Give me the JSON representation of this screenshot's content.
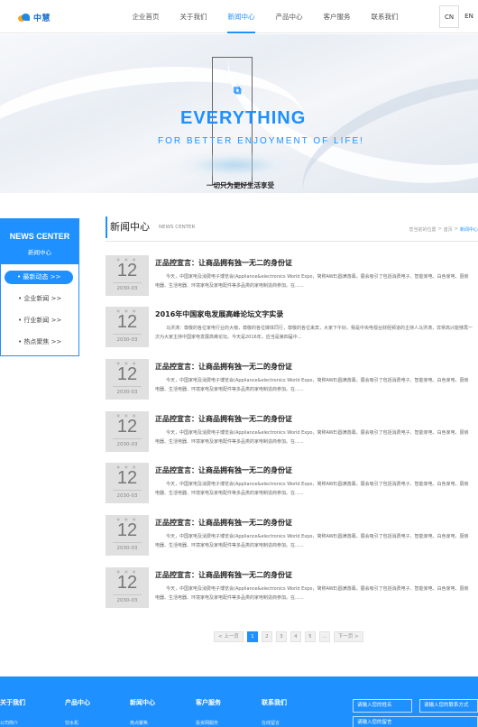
{
  "header": {
    "logo_text": "中慧",
    "nav": [
      "企业首页",
      "关于我们",
      "新闻中心",
      "产品中心",
      "客户服务",
      "联系我们"
    ],
    "active_nav": 2,
    "lang_cn": "CN",
    "lang_en": "EN"
  },
  "banner": {
    "headline": "EVERYTHING",
    "subline": "FOR BETTER ENJOYMENT OF LIFE!",
    "slogan": "一切只为更好生活享受"
  },
  "sidebar": {
    "title_en": "NEWS CENTER",
    "title_zh": "新闻中心",
    "items": [
      "• 最新动态 >>",
      "• 企业新闻 >>",
      "• 行业新闻 >>",
      "• 热点聚焦 >>"
    ],
    "active_index": 0
  },
  "main": {
    "title": "新闻中心",
    "title_en": "NEWS CENTER",
    "breadcrumb": [
      "您当前的位置",
      ">",
      "首页",
      ">",
      "新闻中心"
    ]
  },
  "news": [
    {
      "day": "12",
      "ym": "2030-03",
      "title": "正品控宣言：让商品拥有独一无二的身份证",
      "summary": "今天，中国家电及消费电子博览会(Appliance&electronics World Expo，简称AWE)圆满落幕，展会吸引了包括消费电子、智能家电、白色家电、厨房电器、生活电器、环境家电及家电配件等多品类的家电制造商参加。在......"
    },
    {
      "day": "12",
      "ym": "2030-03",
      "title": "2016年中国家电发展高峰论坛文字实录",
      "summary": "马洪涛：尊敬的各位家电行业的大咖，尊敬的各位媒体同行，尊敬的各位来宾，大家下午好。我是中央电视台财经频道的主持人马洪涛，非常高兴能够再一次为大家主持中国家电发展高峰论坛。今天是2016年，应当是第四届中..."
    },
    {
      "day": "12",
      "ym": "2030-03",
      "title": "正品控宣言：让商品拥有独一无二的身份证",
      "summary": "今天，中国家电及消费电子博览会(Appliance&electronics World Expo，简称AWE)圆满落幕，展会吸引了包括消费电子、智能家电、白色家电、厨房电器、生活电器、环境家电及家电配件等多品类的家电制造商参加。在......"
    },
    {
      "day": "12",
      "ym": "2030-03",
      "title": "正品控宣言：让商品拥有独一无二的身份证",
      "summary": "今天，中国家电及消费电子博览会(Appliance&electronics World Expo，简称AWE)圆满落幕，展会吸引了包括消费电子、智能家电、白色家电、厨房电器、生活电器、环境家电及家电配件等多品类的家电制造商参加。在......"
    },
    {
      "day": "12",
      "ym": "2030-03",
      "title": "正品控宣言：让商品拥有独一无二的身份证",
      "summary": "今天，中国家电及消费电子博览会(Appliance&electronics World Expo，简称AWE)圆满落幕，展会吸引了包括消费电子、智能家电、白色家电、厨房电器、生活电器、环境家电及家电配件等多品类的家电制造商参加。在......"
    },
    {
      "day": "12",
      "ym": "2030-03",
      "title": "正品控宣言：让商品拥有独一无二的身份证",
      "summary": "今天，中国家电及消费电子博览会(Appliance&electronics World Expo，简称AWE)圆满落幕，展会吸引了包括消费电子、智能家电、白色家电、厨房电器、生活电器、环境家电及家电配件等多品类的家电制造商参加。在......"
    },
    {
      "day": "12",
      "ym": "2030-03",
      "title": "正品控宣言：让商品拥有独一无二的身份证",
      "summary": "今天，中国家电及消费电子博览会(Appliance&electronics World Expo，简称AWE)圆满落幕，展会吸引了包括消费电子、智能家电、白色家电、厨房电器、生活电器、环境家电及家电配件等多品类的家电制造商参加。在......"
    }
  ],
  "pager": {
    "prev": "< 上一页",
    "pages": [
      "1",
      "2",
      "3",
      "4",
      "5",
      "..."
    ],
    "current": 0,
    "next": "下一页 >"
  },
  "footer": {
    "cols": [
      {
        "h": "关于我们",
        "l": "公司简介"
      },
      {
        "h": "产品中心",
        "l": "饮水机"
      },
      {
        "h": "新闻中心",
        "l": "热点聚焦"
      },
      {
        "h": "客户服务",
        "l": "投资网服务"
      },
      {
        "h": "联系我们",
        "l": "在线留言"
      }
    ],
    "name_placeholder": "请输入您的姓名",
    "contact_placeholder": "请输入您的联系方式",
    "message_placeholder": "请输入您的留言"
  },
  "colors": {
    "accent": "#1e90ff",
    "date_bg": "#e0e0e0"
  }
}
